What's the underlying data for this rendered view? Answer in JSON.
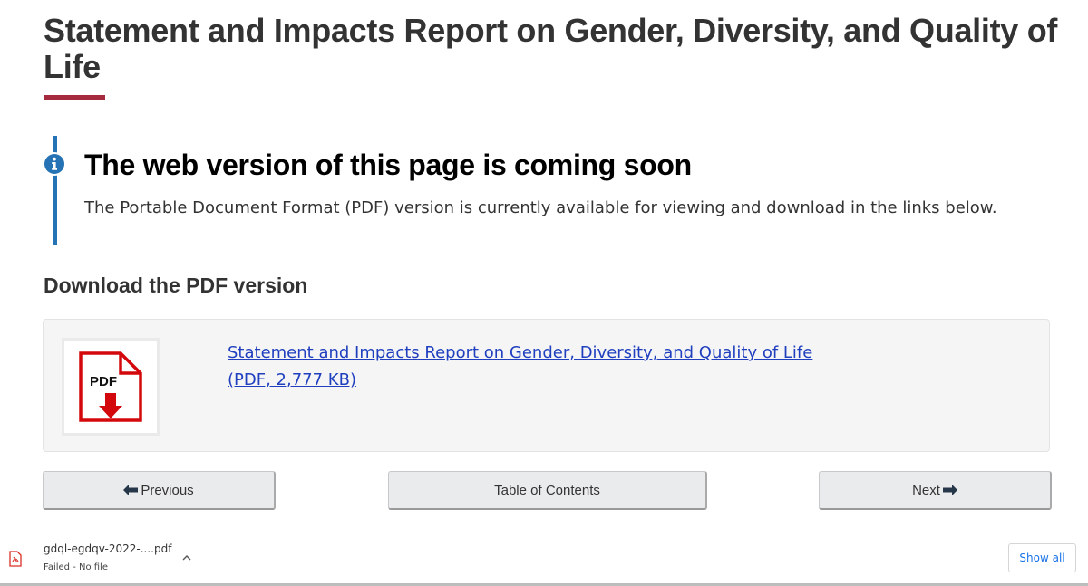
{
  "page": {
    "title": "Statement and Impacts Report on Gender, Diversity, and Quality of Life"
  },
  "alert": {
    "heading": "The web version of this page is coming soon",
    "text": "The Portable Document Format (PDF) version is currently available for viewing and download in the links below."
  },
  "download_section": {
    "heading": "Download the PDF version",
    "thumbnail_label": "PDF",
    "link_text": "Statement and Impacts Report on Gender, Diversity, and Quality of Life",
    "size_text": "(PDF, 2,777 KB)"
  },
  "navigation": {
    "previous_label": "Previous",
    "toc_label": "Table of Contents",
    "next_label": "Next"
  },
  "download_bar": {
    "filename": "gdql-egdqv-2022-....pdf",
    "status": "Failed - No file",
    "show_all_label": "Show all"
  },
  "colors": {
    "accent_rule": "#a62a3e",
    "info_blue": "#2572b4",
    "link": "#1f3fbf",
    "pdf_red": "#d3080c"
  },
  "icons": {
    "alert": "info-circle-icon",
    "pdf": "pdf-download-icon",
    "previous": "arrow-left-icon",
    "next": "arrow-right-icon",
    "chevron": "chevron-up-icon",
    "file": "pdf-file-icon"
  }
}
